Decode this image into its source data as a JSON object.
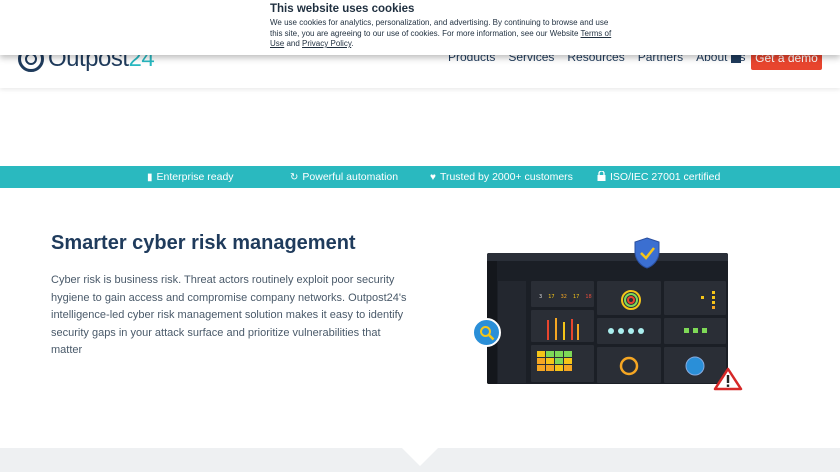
{
  "header": {
    "logo_text": "Outpost",
    "logo_num": "24",
    "nav": [
      "Products",
      "Services",
      "Resources",
      "Partners",
      "About Us"
    ],
    "demo_label": "Get a demo"
  },
  "cookie": {
    "title": "This website uses cookies",
    "text_before": "We use cookies for analytics, personalization, and advertising. By continuing to browse and use this site, you are agreeing to our use of cookies. For more information, see our Website ",
    "terms_link": "Terms of Use",
    "and": " and ",
    "privacy_link": "Privacy Policy",
    "text_after": "."
  },
  "ribbon": {
    "items": [
      {
        "icon": "building-icon",
        "label": "Enterprise ready"
      },
      {
        "icon": "refresh-icon",
        "label": "Powerful automation"
      },
      {
        "icon": "heart-icon",
        "label": "Trusted by 2000+ customers"
      },
      {
        "icon": "lock-icon",
        "label": "ISO/IEC 27001 certified"
      }
    ],
    "color": "#2ab9bf"
  },
  "main": {
    "title": "Smarter cyber risk management",
    "body": "Cyber risk is business risk. Threat actors routinely exploit poor security hygiene to gain access and compromise company networks. Outpost24's intelligence-led cyber risk management solution makes it easy to identify security gaps in your attack surface and prioritize vulnerabilities that matter"
  },
  "dashboard": {
    "counts": [
      "3",
      "17",
      "32",
      "17",
      "18"
    ]
  },
  "colors": {
    "brand_dark": "#1f3b5c",
    "accent": "#2ab9bf",
    "cta": "#e8452e"
  }
}
